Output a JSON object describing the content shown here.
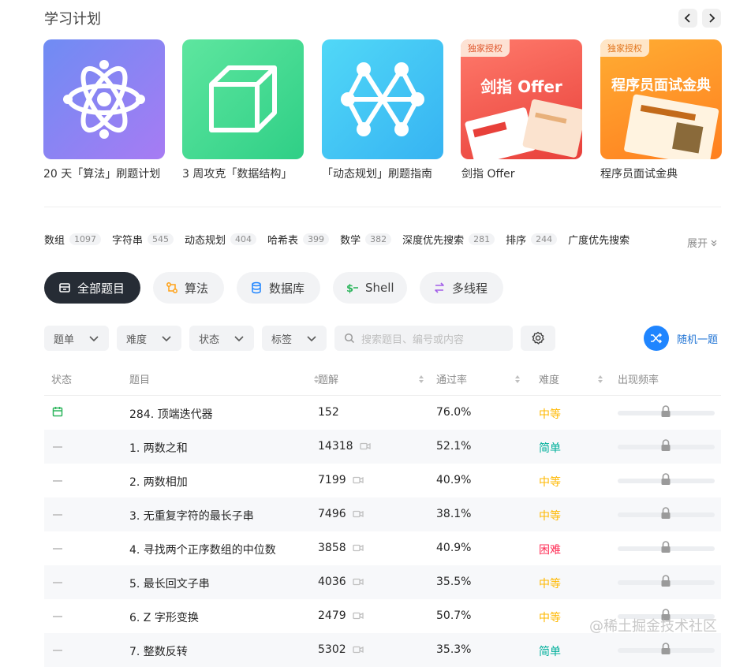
{
  "section": {
    "title": "学习计划"
  },
  "cards": [
    {
      "label": "20 天「算法」刷题计划",
      "icon": "atom-icon"
    },
    {
      "label": "3 周攻克「数据结构」",
      "icon": "cube-icon"
    },
    {
      "label": "「动态规划」刷题指南",
      "icon": "graph-icon"
    },
    {
      "label": "剑指 Offer",
      "badge": "独家授权",
      "cover_title": "剑指 Offer"
    },
    {
      "label": "程序员面试金典",
      "badge": "独家授权",
      "cover_title": "程序员面试金典"
    }
  ],
  "tags": [
    {
      "name": "数组",
      "count": "1097"
    },
    {
      "name": "字符串",
      "count": "545"
    },
    {
      "name": "动态规划",
      "count": "404"
    },
    {
      "name": "哈希表",
      "count": "399"
    },
    {
      "name": "数学",
      "count": "382"
    },
    {
      "name": "深度优先搜索",
      "count": "281"
    },
    {
      "name": "排序",
      "count": "244"
    },
    {
      "name": "广度优先搜索",
      "count": ""
    }
  ],
  "expand_label": "展开",
  "categories": [
    {
      "label": "全部题目",
      "icon": "inbox-icon",
      "active": true
    },
    {
      "label": "算法",
      "icon": "algorithm-icon"
    },
    {
      "label": "数据库",
      "icon": "database-icon"
    },
    {
      "label": "Shell",
      "icon": "shell-icon"
    },
    {
      "label": "多线程",
      "icon": "multithread-icon"
    }
  ],
  "filters": [
    "题单",
    "难度",
    "状态",
    "标签"
  ],
  "search": {
    "placeholder": "搜索题目、编号或内容"
  },
  "random_label": "随机一题",
  "columns": [
    "状态",
    "题目",
    "题解",
    "通过率",
    "难度",
    "出现频率"
  ],
  "colors": {
    "easy": "#00af9b",
    "medium": "#ffb800",
    "hard": "#ff2d55",
    "accent": "#1f85ff"
  },
  "rows": [
    {
      "status": "calendar",
      "title": "284. 顶端迭代器",
      "solutions": "152",
      "video": false,
      "rate": "76.0%",
      "difficulty": "中等",
      "level": "medium"
    },
    {
      "status": "none",
      "title": "1. 两数之和",
      "solutions": "14318",
      "video": true,
      "rate": "52.1%",
      "difficulty": "简单",
      "level": "easy"
    },
    {
      "status": "none",
      "title": "2. 两数相加",
      "solutions": "7199",
      "video": true,
      "rate": "40.9%",
      "difficulty": "中等",
      "level": "medium"
    },
    {
      "status": "none",
      "title": "3. 无重复字符的最长子串",
      "solutions": "7496",
      "video": true,
      "rate": "38.1%",
      "difficulty": "中等",
      "level": "medium"
    },
    {
      "status": "none",
      "title": "4. 寻找两个正序数组的中位数",
      "solutions": "3858",
      "video": true,
      "rate": "40.9%",
      "difficulty": "困难",
      "level": "hard"
    },
    {
      "status": "none",
      "title": "5. 最长回文子串",
      "solutions": "4036",
      "video": true,
      "rate": "35.5%",
      "difficulty": "中等",
      "level": "medium"
    },
    {
      "status": "none",
      "title": "6. Z 字形变换",
      "solutions": "2479",
      "video": true,
      "rate": "50.7%",
      "difficulty": "中等",
      "level": "medium"
    },
    {
      "status": "none",
      "title": "7. 整数反转",
      "solutions": "5302",
      "video": true,
      "rate": "35.3%",
      "difficulty": "简单",
      "level": "easy"
    }
  ],
  "watermark": "@稀土掘金技术社区"
}
